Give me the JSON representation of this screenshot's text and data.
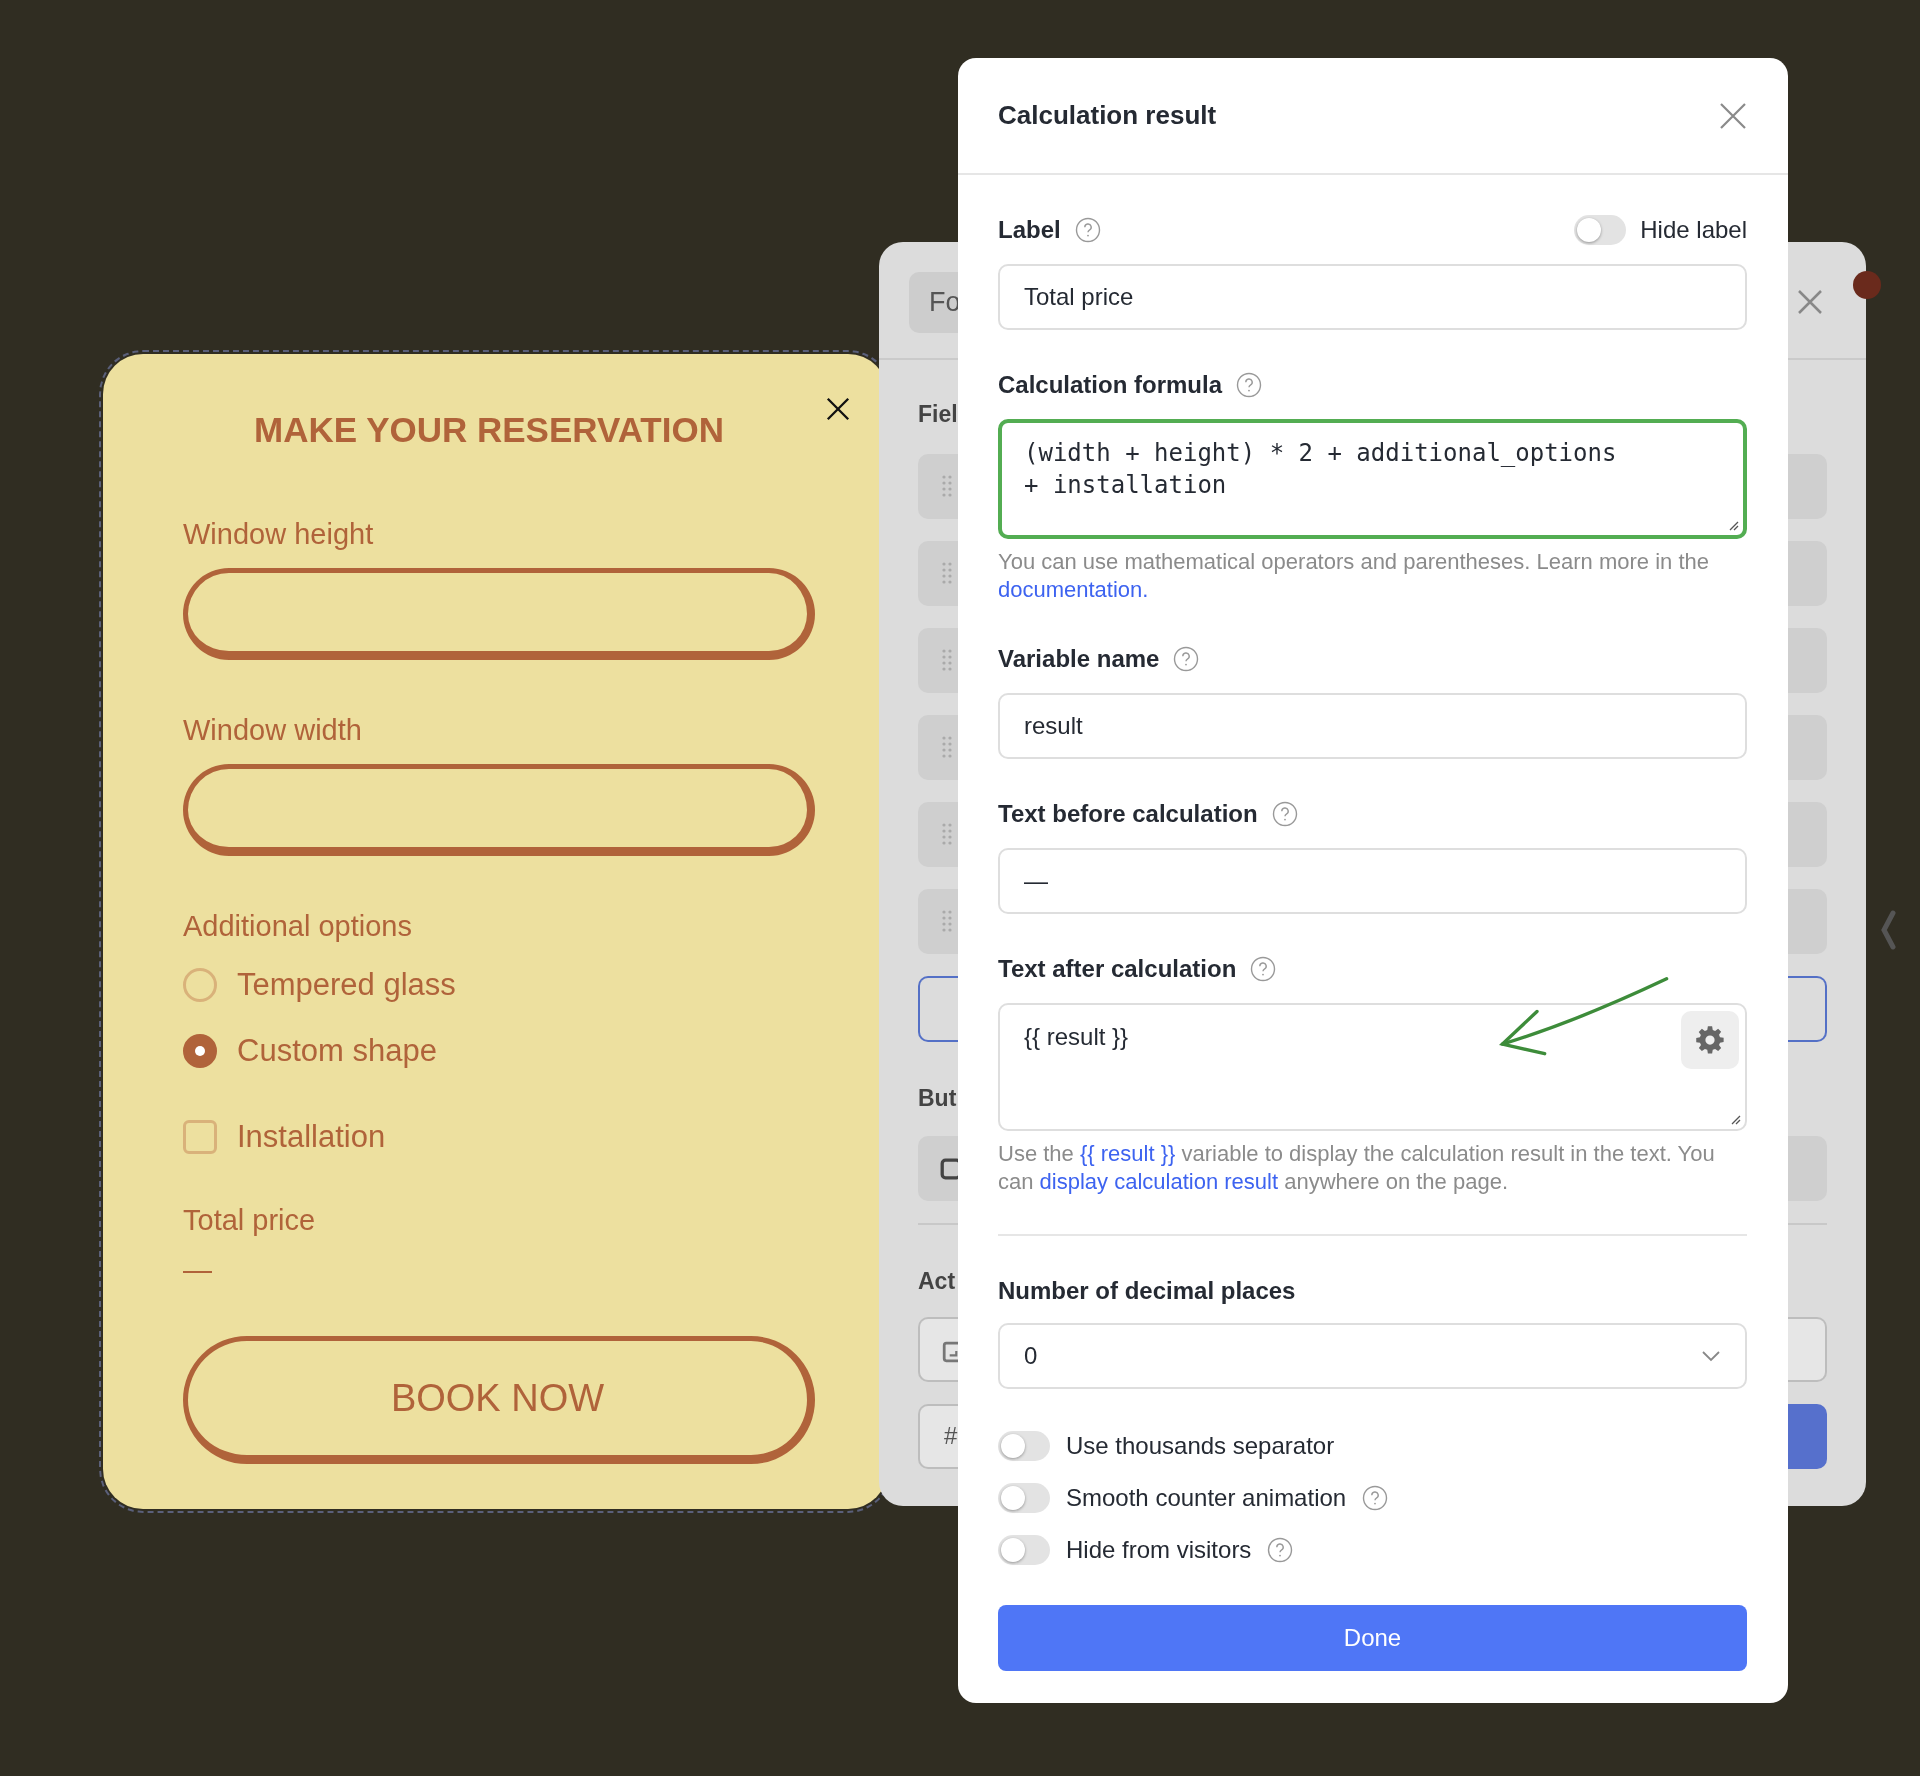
{
  "reservation_form": {
    "title": "MAKE YOUR RESERVATION",
    "fields": [
      {
        "label": "Window height"
      },
      {
        "label": "Window width"
      }
    ],
    "options_label": "Additional options",
    "options": [
      {
        "kind": "radio",
        "label": "Tempered glass",
        "selected": false
      },
      {
        "kind": "radio",
        "label": "Custom shape",
        "selected": true
      },
      {
        "kind": "checkbox",
        "label": "Installation",
        "checked": false
      }
    ],
    "total_label": "Total price",
    "total_value": "—",
    "button": "BOOK NOW"
  },
  "background_panel": {
    "tab": "Fo",
    "section_labels": [
      "Fiel",
      "But",
      "Act"
    ],
    "input_prefix": "#"
  },
  "modal": {
    "title": "Calculation result",
    "hide_label": {
      "label": "Hide label",
      "on": false
    },
    "fields": [
      {
        "kind": "input",
        "label": "Label",
        "help": true,
        "value": "Total price",
        "focused": false
      },
      {
        "kind": "code",
        "label": "Calculation formula",
        "help": true,
        "value": "(width + height) * 2 + additional_options + installation",
        "focused": true,
        "hint": [
          {
            "text": "You can use mathematical operators and parentheses. Learn more in the "
          },
          {
            "text": "documentation.",
            "link": true
          }
        ]
      },
      {
        "kind": "input",
        "label": "Variable name",
        "help": true,
        "value": "result",
        "focused": false
      },
      {
        "kind": "input",
        "label": "Text before calculation",
        "help": true,
        "value": "—",
        "focused": false
      },
      {
        "kind": "textarea",
        "label": "Text after calculation",
        "help": true,
        "value": "{{ result }}",
        "focused": false,
        "hint": [
          {
            "text": "Use the "
          },
          {
            "text": "{{ result }}",
            "link": true
          },
          {
            "text": " variable to display the calculation result in the text. You can "
          },
          {
            "text": "display calculation result",
            "link": true
          },
          {
            "text": " anywhere on the page."
          }
        ]
      }
    ],
    "decimal": {
      "label": "Number of decimal places",
      "value": "0"
    },
    "toggles": [
      {
        "label": "Use thousands separator",
        "on": false,
        "help": false
      },
      {
        "label": "Smooth counter animation",
        "on": false,
        "help": true
      },
      {
        "label": "Hide from visitors",
        "on": false,
        "help": true
      }
    ],
    "done": "Done"
  }
}
